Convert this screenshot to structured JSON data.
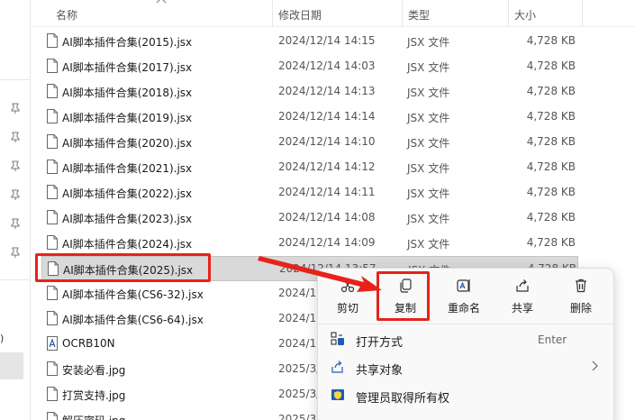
{
  "header": {
    "name": "名称",
    "date": "修改日期",
    "type": "类型",
    "size": "大小"
  },
  "sidebar": {
    "paren": ")"
  },
  "files": [
    {
      "name": "AI脚本插件合集(2015).jsx",
      "date": "2024/12/14 14:15",
      "type": "JSX 文件",
      "size": "4,728 KB",
      "icon": "jsx-file-icon"
    },
    {
      "name": "AI脚本插件合集(2017).jsx",
      "date": "2024/12/14 14:03",
      "type": "JSX 文件",
      "size": "4,728 KB",
      "icon": "jsx-file-icon"
    },
    {
      "name": "AI脚本插件合集(2018).jsx",
      "date": "2024/12/14 14:13",
      "type": "JSX 文件",
      "size": "4,728 KB",
      "icon": "jsx-file-icon"
    },
    {
      "name": "AI脚本插件合集(2019).jsx",
      "date": "2024/12/14 14:14",
      "type": "JSX 文件",
      "size": "4,728 KB",
      "icon": "jsx-file-icon"
    },
    {
      "name": "AI脚本插件合集(2020).jsx",
      "date": "2024/12/14 14:10",
      "type": "JSX 文件",
      "size": "4,728 KB",
      "icon": "jsx-file-icon"
    },
    {
      "name": "AI脚本插件合集(2021).jsx",
      "date": "2024/12/14 14:12",
      "type": "JSX 文件",
      "size": "4,728 KB",
      "icon": "jsx-file-icon"
    },
    {
      "name": "AI脚本插件合集(2022).jsx",
      "date": "2024/12/14 14:11",
      "type": "JSX 文件",
      "size": "4,728 KB",
      "icon": "jsx-file-icon"
    },
    {
      "name": "AI脚本插件合集(2023).jsx",
      "date": "2024/12/14 14:08",
      "type": "JSX 文件",
      "size": "4,728 KB",
      "icon": "jsx-file-icon"
    },
    {
      "name": "AI脚本插件合集(2024).jsx",
      "date": "2024/12/14 14:09",
      "type": "JSX 文件",
      "size": "4,728 KB",
      "icon": "jsx-file-icon"
    },
    {
      "name": "AI脚本插件合集(2025).jsx",
      "date": "2024/12/14 13:57",
      "type": "JSX 文件",
      "size": "4,728 KB",
      "icon": "jsx-file-icon"
    },
    {
      "name": "AI脚本插件合集(CS6-32).jsx",
      "date": "2024/12",
      "type": "",
      "size": "",
      "icon": "jsx-file-icon"
    },
    {
      "name": "AI脚本插件合集(CS6-64).jsx",
      "date": "2024/12",
      "type": "",
      "size": "",
      "icon": "jsx-file-icon"
    },
    {
      "name": "OCRB10N",
      "date": "2024/12",
      "type": "",
      "size": "",
      "icon": "font-file-icon"
    },
    {
      "name": "安装必看.jpg",
      "date": "2025/3/",
      "type": "",
      "size": "",
      "icon": "image-file-icon"
    },
    {
      "name": "打赏支持.jpg",
      "date": "2025/3/",
      "type": "",
      "size": "",
      "icon": "image-file-icon"
    },
    {
      "name": "解压密码.jpg",
      "date": "2025/3/",
      "type": "",
      "size": "",
      "icon": "image-file-icon"
    }
  ],
  "context_menu": {
    "quick_actions": [
      {
        "label": "剪切",
        "icon": "scissors-icon"
      },
      {
        "label": "复制",
        "icon": "copy-icon"
      },
      {
        "label": "重命名",
        "icon": "rename-icon"
      },
      {
        "label": "共享",
        "icon": "share-icon"
      },
      {
        "label": "删除",
        "icon": "trash-icon"
      }
    ],
    "items": [
      {
        "label": "打开方式",
        "shortcut": "Enter",
        "icon": "open-with-icon"
      },
      {
        "label": "共享对象",
        "shortcut": "",
        "icon": "share-with-icon"
      },
      {
        "label": "管理员取得所有权",
        "shortcut": "",
        "icon": "shield-icon"
      }
    ]
  },
  "colors": {
    "highlight": "#e8221a",
    "selected_row": "#d9d9d9",
    "accent": "#1a5fb4"
  }
}
